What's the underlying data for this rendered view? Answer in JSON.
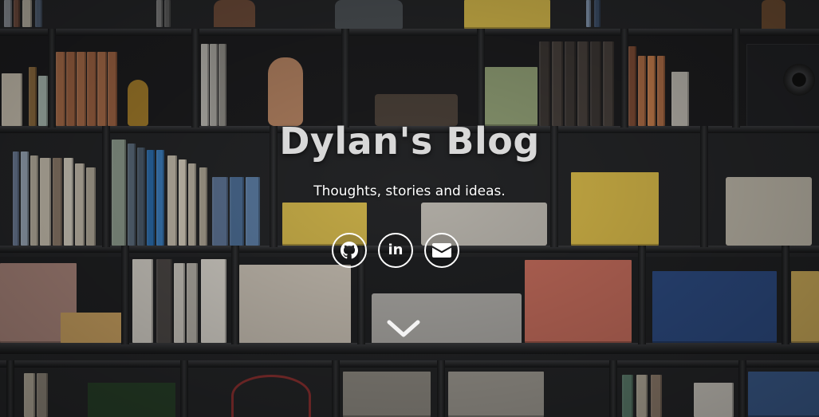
{
  "hero": {
    "title": "Dylan's Blog",
    "tagline": "Thoughts, stories and ideas."
  },
  "social": [
    {
      "name": "github",
      "icon": "github-icon"
    },
    {
      "name": "linkedin",
      "icon": "linkedin-icon",
      "glyph": "in"
    },
    {
      "name": "email",
      "icon": "envelope-icon"
    }
  ],
  "scroll": {
    "icon": "chevron-down-icon"
  },
  "colors": {
    "title": "#d8d8d8",
    "tagline": "#ffffff",
    "icon_ring": "#ffffff",
    "background": "#242527"
  }
}
